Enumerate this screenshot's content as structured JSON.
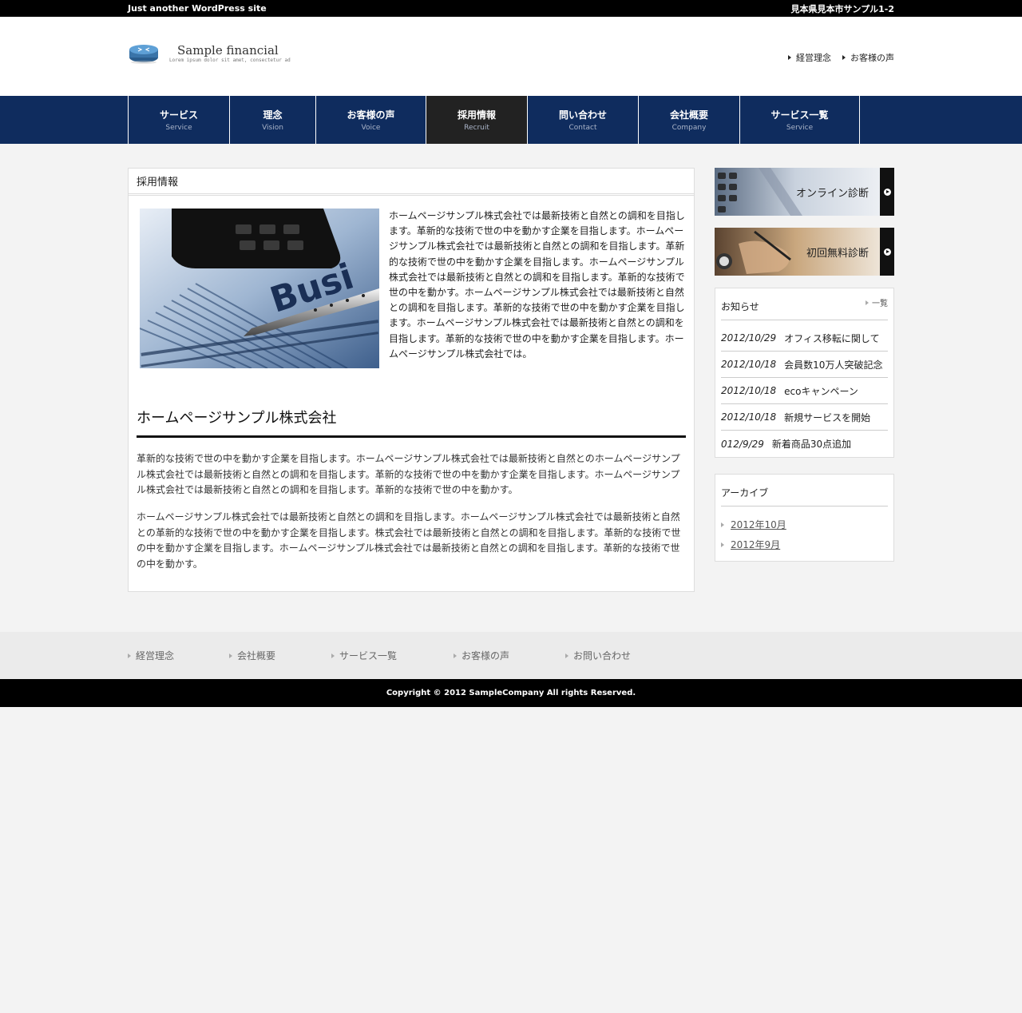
{
  "topbar": {
    "left": "Just another WordPress site",
    "right": "見本県見本市サンプル1-2"
  },
  "logo": {
    "name": "Sample financial",
    "tagline": "Lorem ipsum dolor sit amet, consectetur ad"
  },
  "header_links": [
    "経営理念",
    "お客様の声"
  ],
  "nav": [
    {
      "jp": "サービス",
      "en": "Service"
    },
    {
      "jp": "理念",
      "en": "Vision"
    },
    {
      "jp": "お客様の声",
      "en": "Voice"
    },
    {
      "jp": "採用情報",
      "en": "Recruit"
    },
    {
      "jp": "問い合わせ",
      "en": "Contact"
    },
    {
      "jp": "会社概要",
      "en": "Company"
    },
    {
      "jp": "サービス一覧",
      "en": "Service"
    }
  ],
  "active_nav": "採用情報",
  "content": {
    "title": "採用情報",
    "intro": "ホームページサンプル株式会社では最新技術と自然との調和を目指します。革新的な技術で世の中を動かす企業を目指します。ホームページサンプル株式会社では最新技術と自然との調和を目指します。革新的な技術で世の中を動かす企業を目指します。ホームページサンプル株式会社では最新技術と自然との調和を目指します。革新的な技術で世の中を動かす。ホームページサンプル株式会社では最新技術と自然との調和を目指します。革新的な技術で世の中を動かす企業を目指します。ホームページサンプル株式会社では最新技術と自然との調和を目指します。革新的な技術で世の中を動かす企業を目指します。ホームページサンプル株式会社では。",
    "heading": "ホームページサンプル株式会社",
    "para1": "革新的な技術で世の中を動かす企業を目指します。ホームページサンプル株式会社では最新技術と自然とのホームページサンプル株式会社では最新技術と自然との調和を目指します。革新的な技術で世の中を動かす企業を目指します。ホームページサンプル株式会社では最新技術と自然との調和を目指します。革新的な技術で世の中を動かす。",
    "para2": "ホームページサンプル株式会社では最新技術と自然との調和を目指します。ホームページサンプル株式会社では最新技術と自然との革新的な技術で世の中を動かす企業を目指します。株式会社では最新技術と自然との調和を目指します。革新的な技術で世の中を動かす企業を目指します。ホームページサンプル株式会社では最新技術と自然との調和を目指します。革新的な技術で世の中を動かす。",
    "photo_text": "Busi"
  },
  "sidebar": {
    "banners": [
      "オンライン診断",
      "初回無料診断"
    ],
    "news": {
      "title": "お知らせ",
      "more": "一覧",
      "items": [
        {
          "date": "2012/10/29",
          "text": "オフィス移転に関して"
        },
        {
          "date": "2012/10/18",
          "text": "会員数10万人突破記念"
        },
        {
          "date": "2012/10/18",
          "text": "ecoキャンペーン"
        },
        {
          "date": "2012/10/18",
          "text": "新規サービスを開始"
        },
        {
          "date": "012/9/29",
          "text": "新着商品30点追加"
        }
      ]
    },
    "archive": {
      "title": "アーカイブ",
      "items": [
        "2012年10月",
        "2012年9月"
      ]
    }
  },
  "footer_links": [
    "経営理念",
    "会社概要",
    "サービス一覧",
    "お客様の声",
    "お問い合わせ"
  ],
  "copyright": "Copyright © 2012 SampleCompany All rights Reserved.",
  "colors": {
    "nav_bg": "#0f2c5e",
    "nav_active": "#222222",
    "topbar": "#000000"
  }
}
